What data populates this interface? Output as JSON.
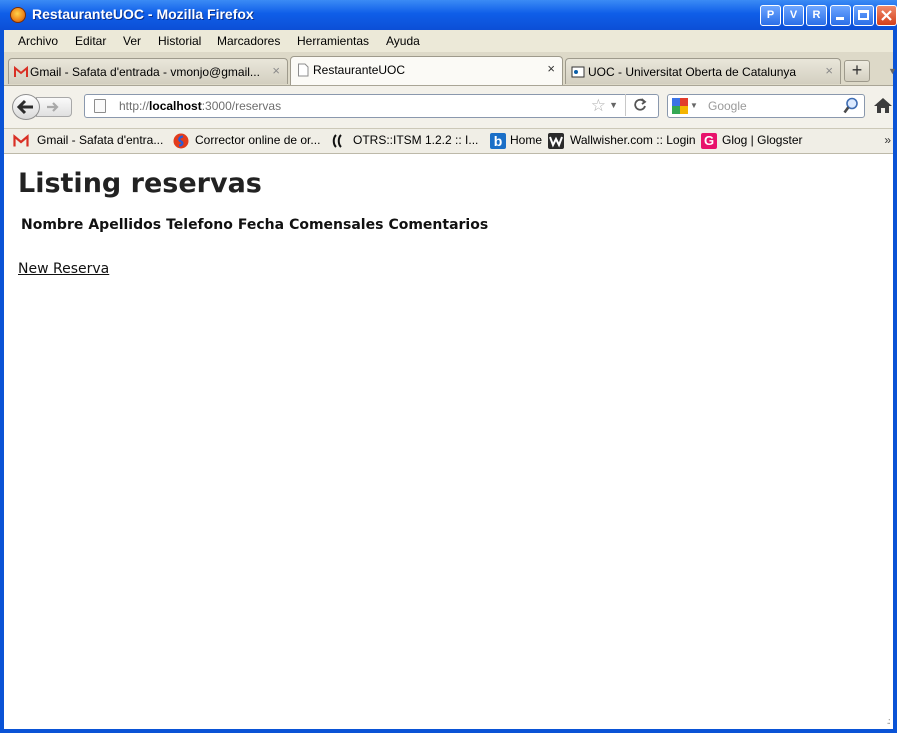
{
  "window": {
    "title": "RestauranteUOC - Mozilla Firefox",
    "extra_buttons": [
      "P",
      "V",
      "R"
    ]
  },
  "menu": {
    "items": [
      "Archivo",
      "Editar",
      "Ver",
      "Historial",
      "Marcadores",
      "Herramientas",
      "Ayuda"
    ]
  },
  "tabs": [
    {
      "label": "Gmail - Safata d'entrada - vmonjo@gmail...",
      "icon": "gmail-icon",
      "active": false
    },
    {
      "label": "RestauranteUOC",
      "icon": "page-icon",
      "active": true
    },
    {
      "label": "UOC - Universitat Oberta de Catalunya",
      "icon": "uoc-icon",
      "active": false
    }
  ],
  "tab_close_glyph": "×",
  "new_tab_glyph": "+",
  "nav": {
    "url_prefix": "http://",
    "url_host": "localhost",
    "url_rest": ":3000/reservas",
    "search_placeholder": "Google"
  },
  "bookmarks": [
    {
      "label": "Gmail - Safata d'entra...",
      "icon": "gmail-icon"
    },
    {
      "label": "Corrector online de or...",
      "icon": "corrector-icon"
    },
    {
      "label": "OTRS::ITSM 1.2.2 :: I...",
      "icon": "otrs-icon"
    },
    {
      "label": "Home",
      "icon": "b-icon"
    },
    {
      "label": "Wallwisher.com :: Login",
      "icon": "wallwisher-icon"
    },
    {
      "label": "Glog | Glogster",
      "icon": "glogster-icon"
    }
  ],
  "bookmarks_more": "»",
  "page": {
    "heading": "Listing reservas",
    "columns": [
      "Nombre",
      "Apellidos",
      "Telefono",
      "Fecha",
      "Comensales",
      "Comentarios"
    ],
    "new_link": "New Reserva"
  },
  "colors": {
    "titlebar": "#0f5ee8",
    "window_border": "#0a53d6",
    "gmail_red": "#d93025",
    "glogster_pink": "#e8126b",
    "b_blue": "#1b6fc7"
  }
}
